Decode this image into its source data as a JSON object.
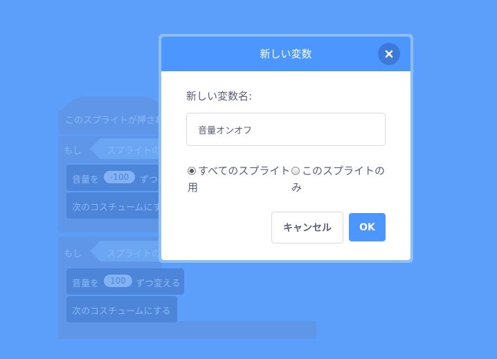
{
  "background_script": {
    "hat_label": "このスプライトが押された",
    "if1_label": "もし",
    "if1_condition": "スプライトの",
    "cmd1_label": "音量を",
    "cmd1_value": "-100",
    "cmd1_suffix": "ずつ変",
    "cmd2_label": "次のコスチュームにす",
    "if2_label": "もし",
    "if2_condition": "スプライトの",
    "cmd3_label": "音量を",
    "cmd3_value": "100",
    "cmd3_suffix": "ずつ変える",
    "cmd4_label": "次のコスチュームにする"
  },
  "dialog": {
    "title": "新しい変数",
    "close_icon": "close-icon",
    "name_label": "新しい変数名:",
    "name_value": "音量オンオフ",
    "scope_options": [
      {
        "label": "すべてのスプライト用",
        "selected": true
      },
      {
        "label": "このスプライトのみ",
        "selected": false
      }
    ],
    "cancel_label": "キャンセル",
    "ok_label": "OK"
  },
  "colors": {
    "background": "#5c9ffb",
    "header": "#4c97ff",
    "close_button": "#3d7ad8",
    "text": "#575e75"
  }
}
